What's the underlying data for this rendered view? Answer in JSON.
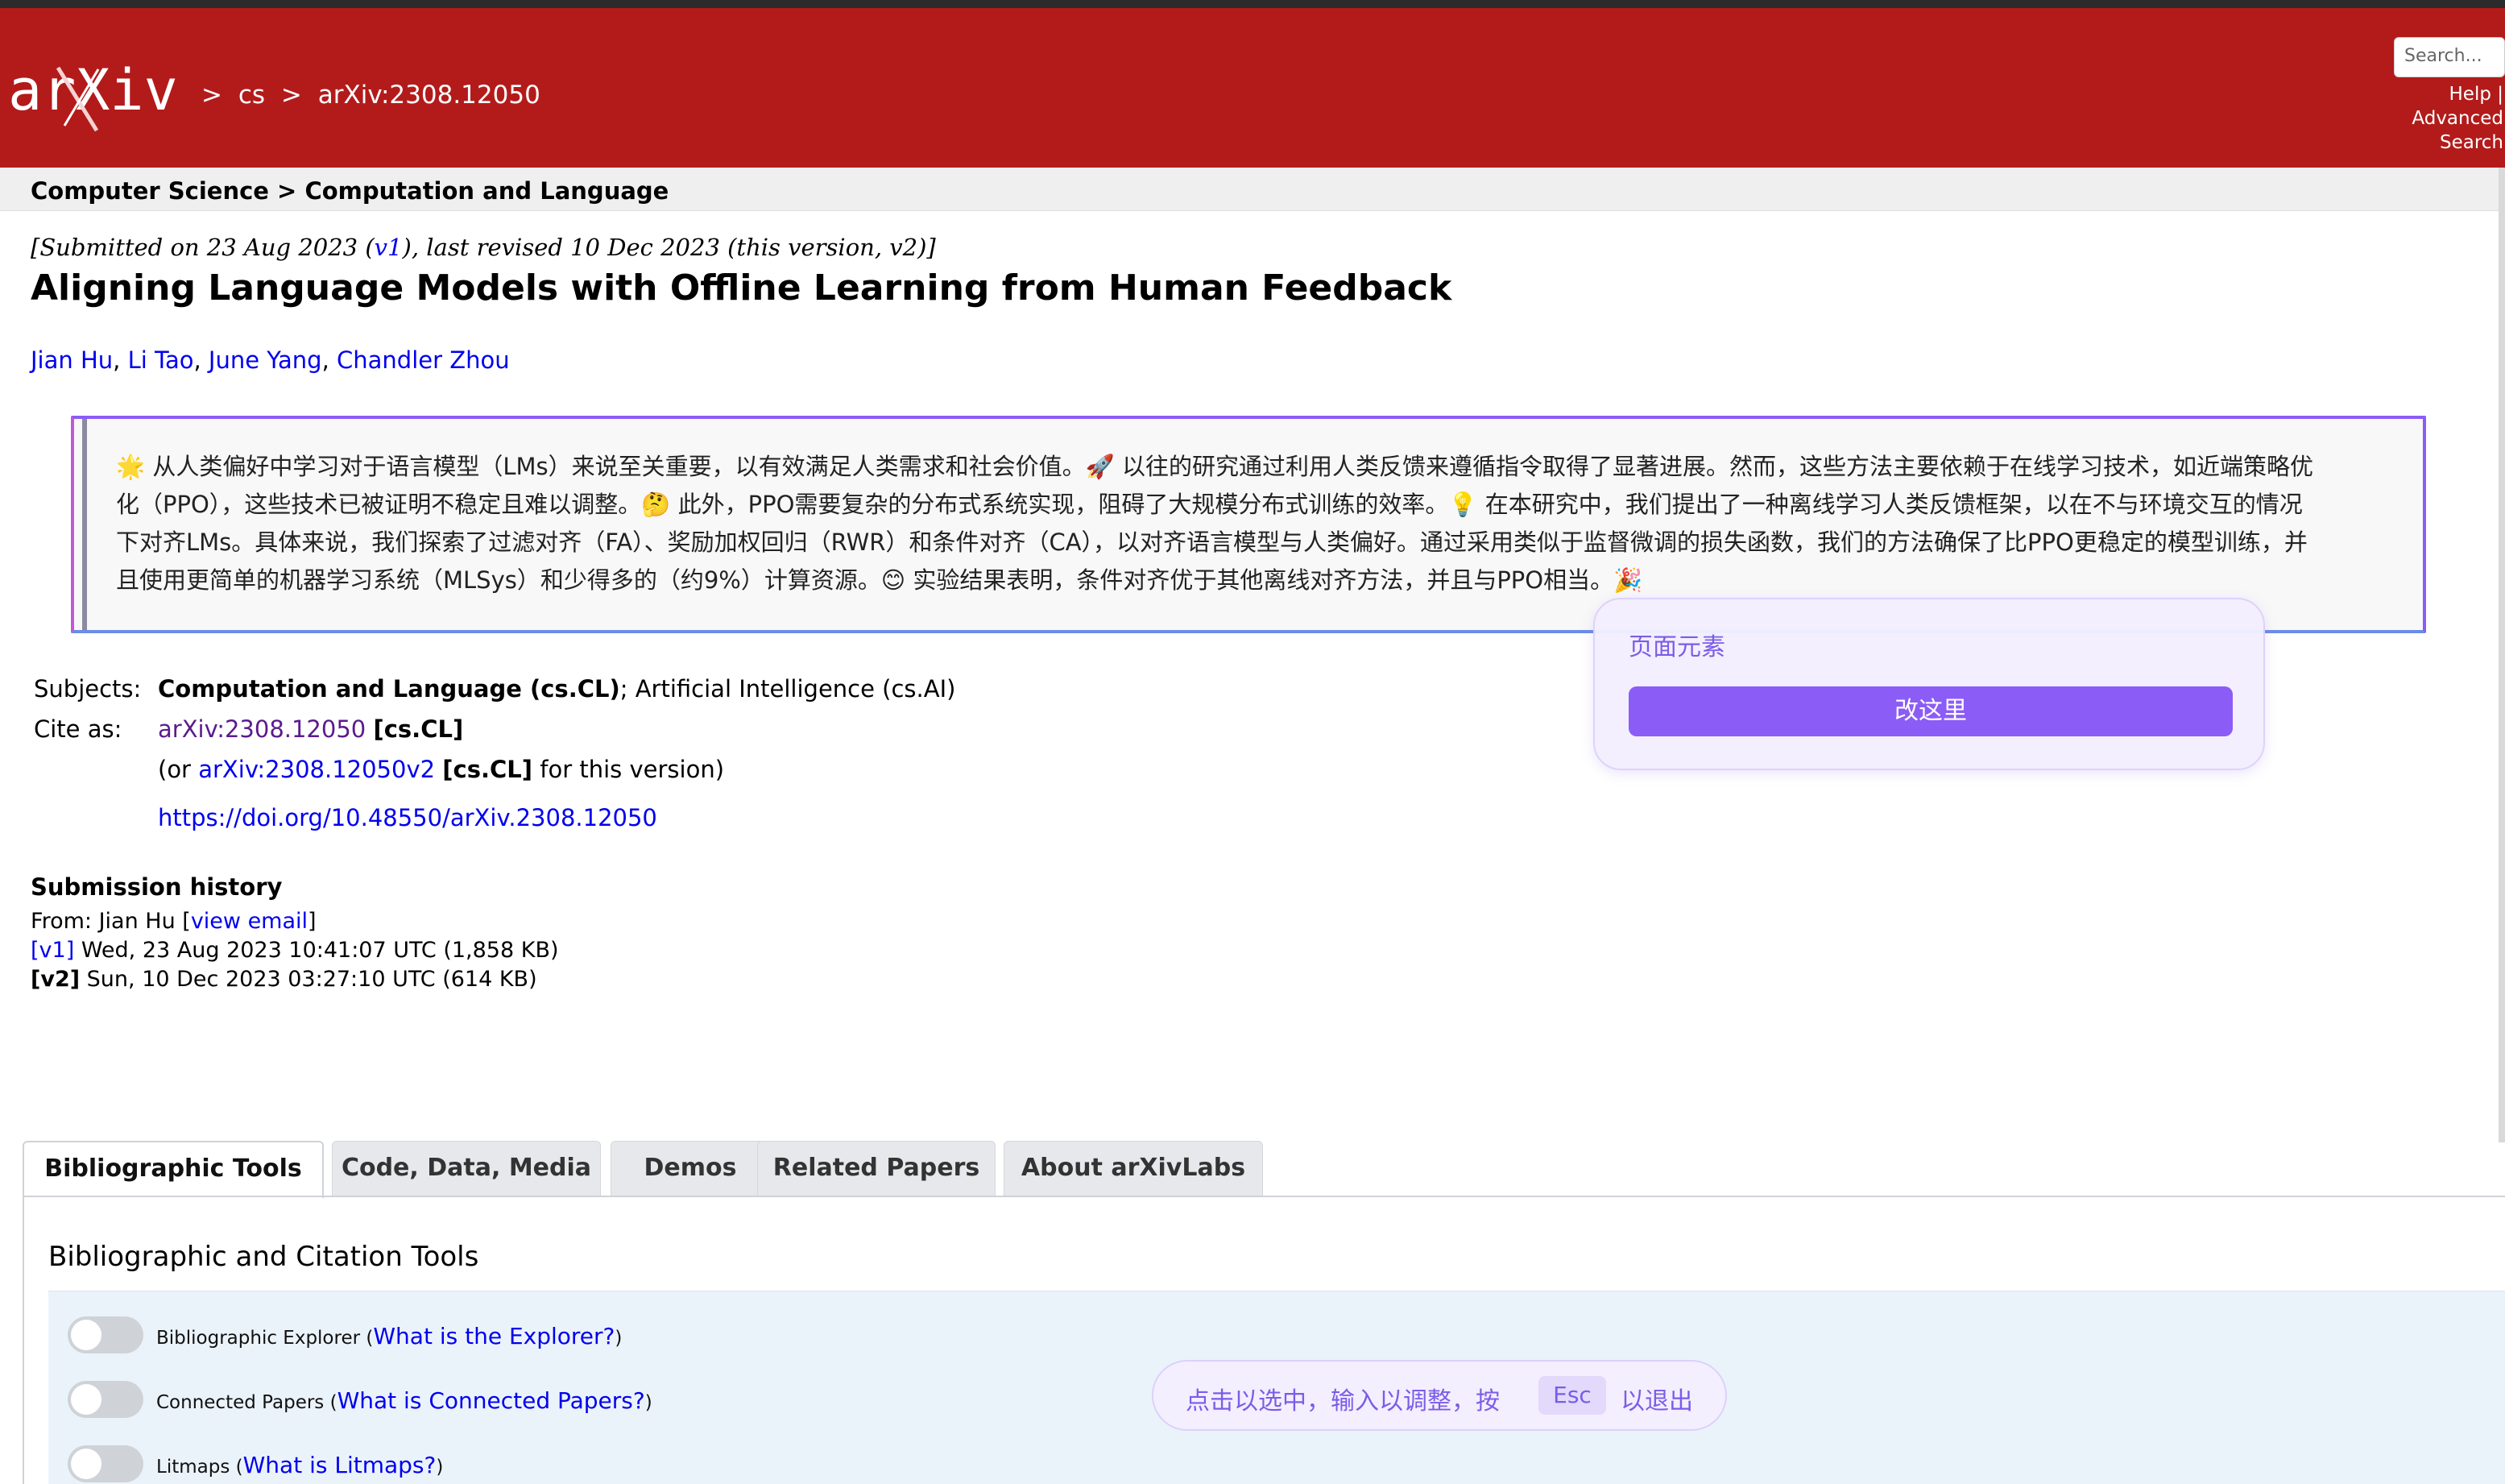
{
  "header": {
    "logo_text": "arXiv",
    "breadcrumb": [
      ">",
      "cs",
      ">",
      "arXiv:2308.12050"
    ],
    "search_placeholder": "Search...",
    "links": [
      "Help |",
      "Advanced",
      "Search"
    ]
  },
  "subheader": {
    "text": "Computer Science > Computation and Language"
  },
  "paper": {
    "dateline_a": "[Submitted on 23 Aug 2023 (",
    "dateline_v1": "v1",
    "dateline_b": "), last revised 10 Dec 2023 (this version, v2)]",
    "title": "Aligning Language Models with Offline Learning from Human Feedback",
    "authors": [
      "Jian Hu",
      "Li Tao",
      "June Yang",
      "Chandler Zhou"
    ],
    "abstract_lines": [
      "🌟 从人类偏好中学习对于语言模型（LMs）来说至关重要，以有效满足人类需求和社会价值。🚀 以往的研究通过利用人类反馈来遵循指令取得了显著进展。然而，这些方法主要依赖于在线学习技术，如近端策略优",
      "化（PPO），这些技术已被证明不稳定且难以调整。🤔 此外，PPO需要复杂的分布式系统实现，阻碍了大规模分布式训练的效率。💡 在本研究中，我们提出了一种离线学习人类反馈框架，以在不与环境交互的情况",
      "下对齐LMs。具体来说，我们探索了过滤对齐（FA）、奖励加权回归（RWR）和条件对齐（CA），以对齐语言模型与人类偏好。通过采用类似于监督微调的损失函数，我们的方法确保了比PPO更稳定的模型训练，并",
      "且使用更简单的机器学习系统（MLSys）和少得多的（约9%）计算资源。😊 实验结果表明，条件对齐优于其他离线对齐方法，并且与PPO相当。🎉"
    ]
  },
  "popover": {
    "title": "页面元素",
    "button": "改这里"
  },
  "meta": {
    "subjects_label": "Subjects:",
    "subjects_bold": "Computation and Language (cs.CL)",
    "subjects_rest": "; Artificial Intelligence (cs.AI)",
    "cite_label": "Cite as:",
    "cite_link": "arXiv:2308.12050",
    "cite_tag": "[cs.CL]",
    "cite2_a": "(or ",
    "cite2_link": "arXiv:2308.12050v2",
    "cite2_tag": "[cs.CL]",
    "cite2_b": " for this version)",
    "doi": "https://doi.org/10.48550/arXiv.2308.12050"
  },
  "submission": {
    "title": "Submission history",
    "from_a": "From: Jian Hu [",
    "from_link": "view email",
    "from_b": "]",
    "v1_link": "[v1]",
    "v1_text": " Wed, 23 Aug 2023 10:41:07 UTC (1,858 KB)",
    "v2_label": "[v2]",
    "v2_text": " Sun, 10 Dec 2023 03:27:10 UTC (614 KB)"
  },
  "tabs": [
    "Bibliographic Tools",
    "Code, Data, Media",
    "Demos",
    "Related Papers",
    "About arXivLabs"
  ],
  "tools": {
    "title": "Bibliographic and Citation Tools",
    "items": [
      {
        "label": "Bibliographic Explorer",
        "link": "What is the Explorer?"
      },
      {
        "label": "Connected Papers",
        "link": "What is Connected Papers?"
      },
      {
        "label": "Litmaps",
        "link": "What is Litmaps?"
      }
    ]
  },
  "hint": {
    "before": "点击以选中，输入以调整，按",
    "key": "Esc",
    "after": "以退出"
  },
  "colors": {
    "header_red": "#b31b1b",
    "link_blue": "#0000ee",
    "overlay_purple": "#8b5cf6"
  }
}
